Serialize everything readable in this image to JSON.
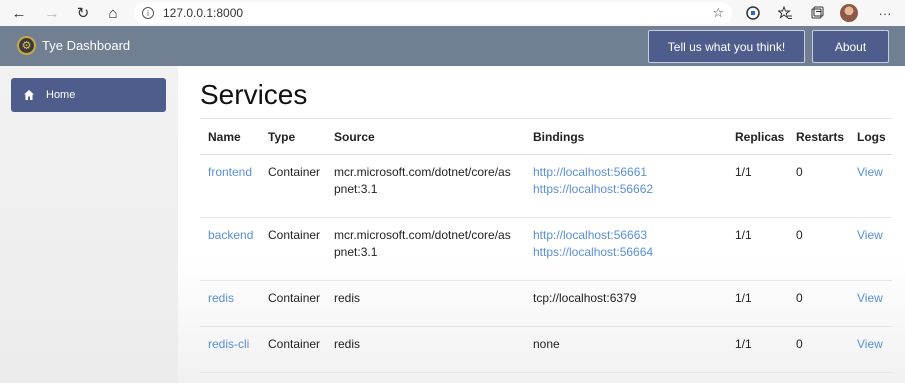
{
  "browser": {
    "url": "127.0.0.1:8000",
    "back_icon": "←",
    "forward_icon": "→",
    "reload_icon": "↻",
    "home_icon": "⌂",
    "star_icon": "☆",
    "more_icon": "···"
  },
  "header": {
    "title": "Tye Dashboard",
    "feedback_label": "Tell us what you think!",
    "about_label": "About"
  },
  "sidebar": {
    "items": [
      {
        "label": "Home",
        "icon": "home-icon"
      }
    ]
  },
  "main": {
    "title": "Services",
    "columns": [
      "Name",
      "Type",
      "Source",
      "Bindings",
      "Replicas",
      "Restarts",
      "Logs"
    ],
    "rows": [
      {
        "name": "frontend",
        "type": "Container",
        "source_line1": "mcr.microsoft.com/dotnet/core/as",
        "source_line2": "pnet:3.1",
        "binding1": "http://localhost:56661",
        "binding2": "https://localhost:56662",
        "replicas": "1/1",
        "restarts": "0",
        "logs": "View"
      },
      {
        "name": "backend",
        "type": "Container",
        "source_line1": "mcr.microsoft.com/dotnet/core/as",
        "source_line2": "pnet:3.1",
        "binding1": "http://localhost:56663",
        "binding2": "https://localhost:56664",
        "replicas": "1/1",
        "restarts": "0",
        "logs": "View"
      },
      {
        "name": "redis",
        "type": "Container",
        "source_line1": "redis",
        "binding1": "tcp://localhost:6379",
        "replicas": "1/1",
        "restarts": "0",
        "logs": "View"
      },
      {
        "name": "redis-cli",
        "type": "Container",
        "source_line1": "redis",
        "binding1": "none",
        "replicas": "1/1",
        "restarts": "0",
        "logs": "View"
      }
    ]
  },
  "colors": {
    "header": "#717f93",
    "accent": "#4e5d8c",
    "link": "#5b8fd6"
  }
}
